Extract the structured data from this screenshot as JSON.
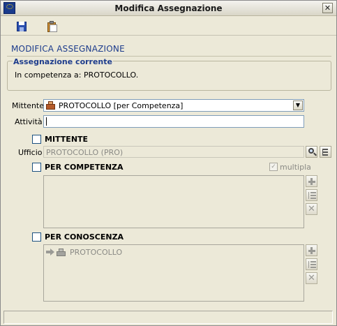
{
  "window": {
    "title": "Modifica Assegnazione",
    "close_label": "✕"
  },
  "toolbar": {
    "save_icon": "save-icon",
    "clipboard_icon": "clipboard-icon"
  },
  "page": {
    "title": "MODIFICA ASSEGNAZIONE"
  },
  "current_assignment": {
    "group_title": "Assegnazione corrente",
    "text": "In competenza a: PROTOCOLLO."
  },
  "form": {
    "mittente_label": "Mittente",
    "mittente_value": "PROTOCOLLO [per Competenza]",
    "attivita_label": "Attività",
    "attivita_value": "",
    "mittente_checkbox_label": "MITTENTE",
    "ufficio_label": "Ufficio",
    "ufficio_value": "PROTOCOLLO (PRO)",
    "per_competenza_label": "PER COMPETENZA",
    "multipla_label": "multipla",
    "multipla_checked": true,
    "per_conoscenza_label": "PER CONOSCENZA",
    "conoscenza_items": [
      "PROTOCOLLO"
    ]
  },
  "colors": {
    "accent": "#1d3c8c",
    "window_bg": "#ece9d8",
    "disabled_text": "#8a8a85"
  }
}
